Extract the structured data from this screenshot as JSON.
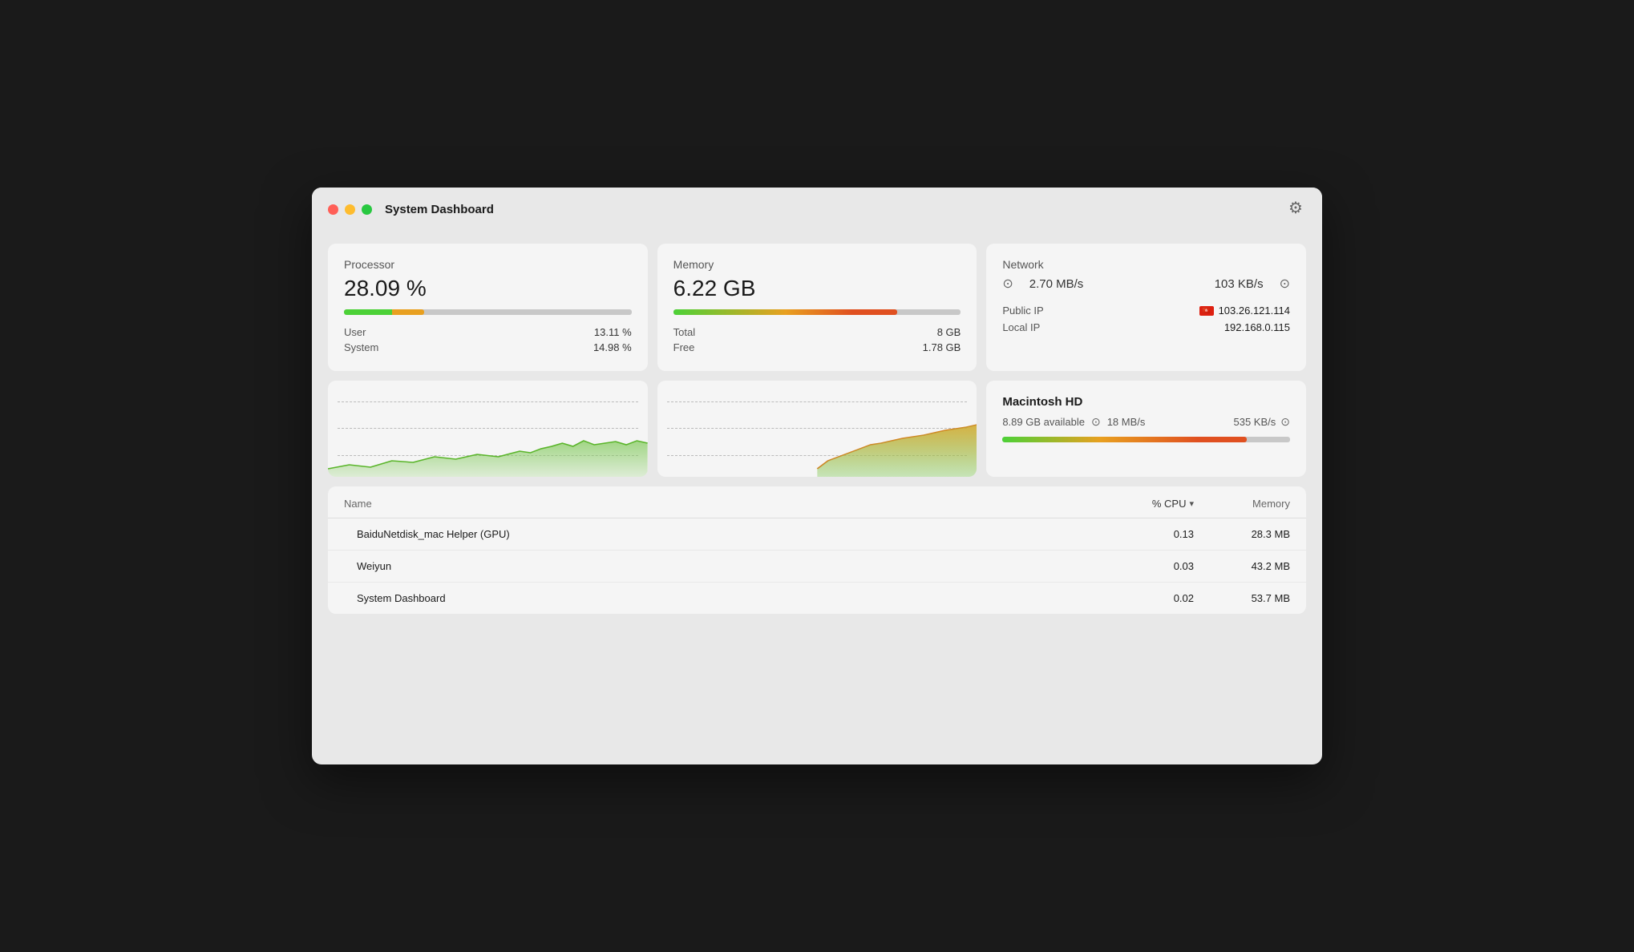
{
  "window": {
    "title": "System Dashboard"
  },
  "processor": {
    "title": "Processor",
    "value": "28.09 %",
    "progress": 28,
    "user_label": "User",
    "user_value": "13.11 %",
    "system_label": "System",
    "system_value": "14.98 %"
  },
  "memory": {
    "title": "Memory",
    "value": "6.22 GB",
    "progress": 78,
    "total_label": "Total",
    "total_value": "8 GB",
    "free_label": "Free",
    "free_value": "1.78 GB"
  },
  "network": {
    "title": "Network",
    "upload_speed": "2.70 MB/s",
    "download_speed": "103 KB/s",
    "public_ip_label": "Public IP",
    "public_ip": "103.26.121.114",
    "local_ip_label": "Local IP",
    "local_ip": "192.168.0.115"
  },
  "macintosh_hd": {
    "title": "Macintosh HD",
    "available": "8.89 GB available",
    "read_speed": "18 MB/s",
    "write_speed": "535 KB/s",
    "progress": 85
  },
  "process_table": {
    "col_name": "Name",
    "col_cpu": "% CPU",
    "col_memory": "Memory",
    "rows": [
      {
        "name": "BaiduNetdisk_mac Helper (GPU)",
        "cpu": "0.13",
        "memory": "28.3 MB"
      },
      {
        "name": "Weiyun",
        "cpu": "0.03",
        "memory": "43.2 MB"
      },
      {
        "name": "System Dashboard",
        "cpu": "0.02",
        "memory": "53.7 MB"
      }
    ]
  },
  "icons": {
    "gear": "⚙",
    "chevron_up": "⊙",
    "chevron_down": "⊙",
    "sort_down": "▾"
  }
}
